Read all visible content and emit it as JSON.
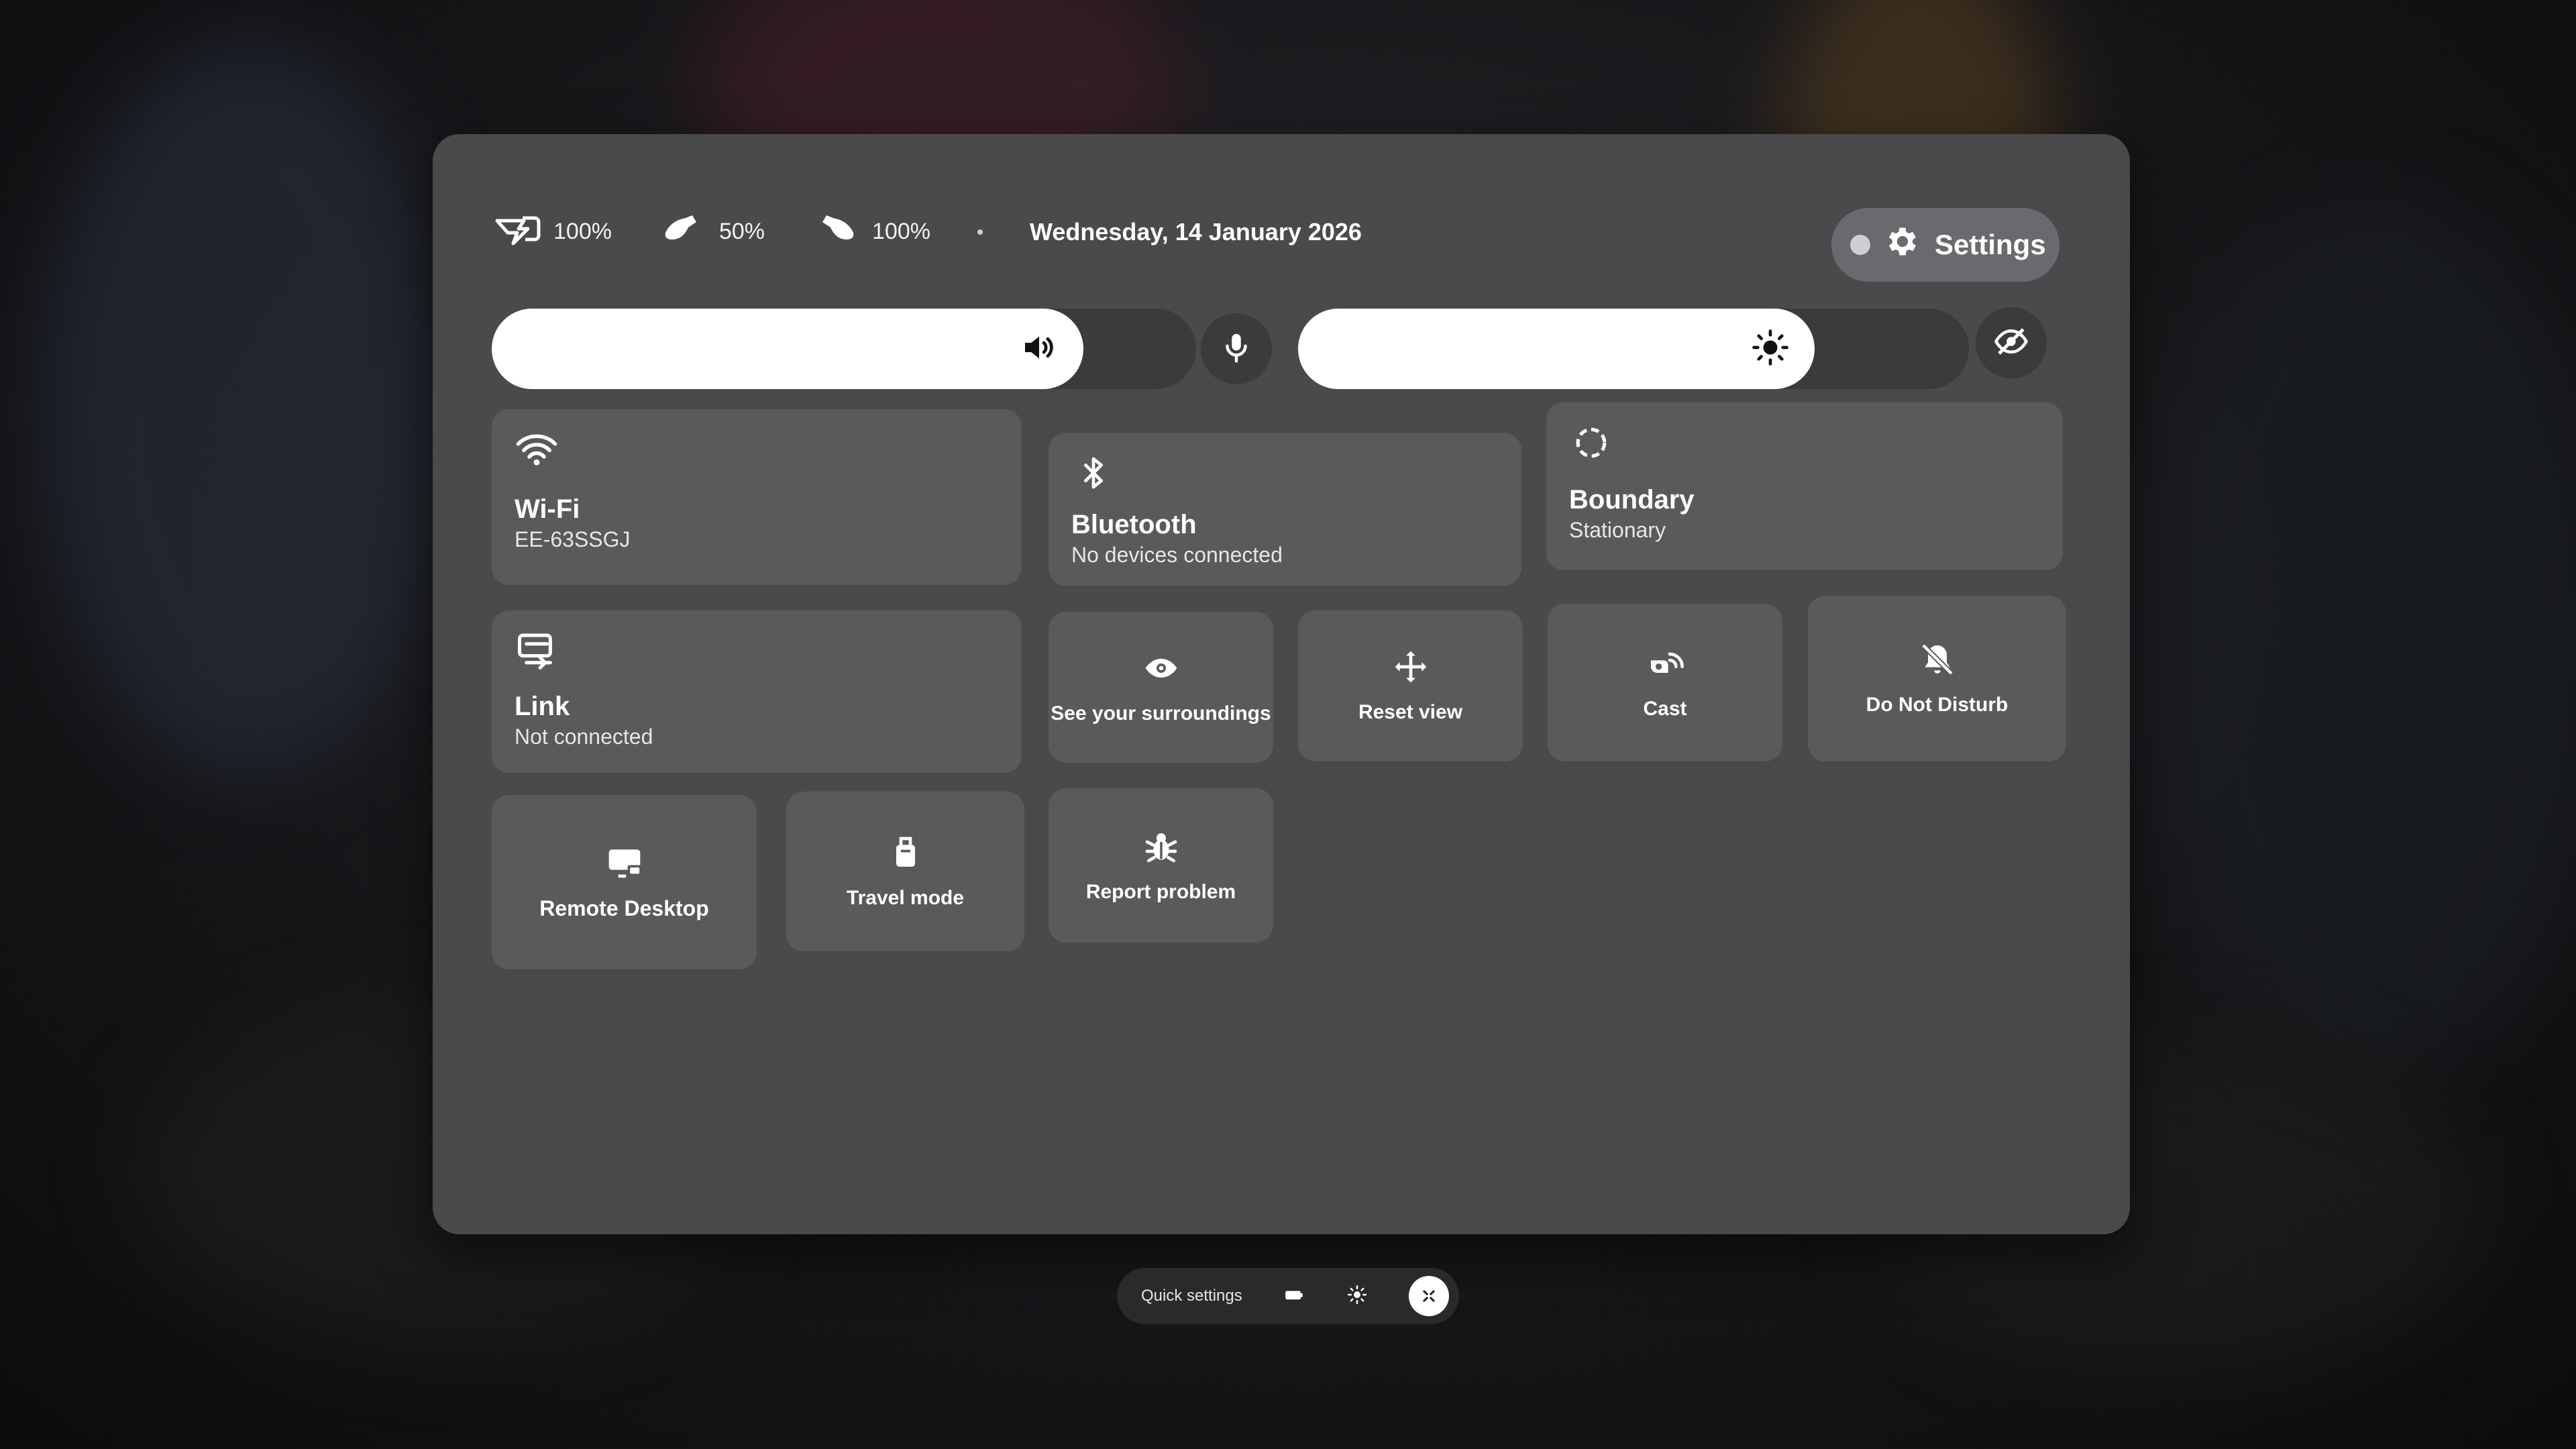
{
  "status": {
    "headset": {
      "icon": "headset-battery-charging-icon",
      "value": "100%"
    },
    "left_controller": {
      "icon": "left-controller-icon",
      "value": "50%"
    },
    "right_controller": {
      "icon": "right-controller-icon",
      "value": "100%"
    },
    "date": "Wednesday, 14 January 2026"
  },
  "settings": {
    "label": "Settings",
    "icon": "gear-icon"
  },
  "sliders": {
    "volume": {
      "icon": "speaker-icon",
      "level": 0.84
    },
    "brightness": {
      "icon": "sun-icon",
      "level": 0.77
    }
  },
  "buttons": {
    "mic": {
      "icon": "microphone-icon"
    },
    "privacy": {
      "icon": "eye-off-icon"
    }
  },
  "tiles": {
    "wifi": {
      "title": "Wi-Fi",
      "subtitle": "EE-63SSGJ",
      "icon": "wifi-icon"
    },
    "bluetooth": {
      "title": "Bluetooth",
      "subtitle": "No devices connected",
      "icon": "bluetooth-icon"
    },
    "boundary": {
      "title": "Boundary",
      "subtitle": "Stationary",
      "icon": "boundary-icon"
    },
    "link": {
      "title": "Link",
      "subtitle": "Not connected",
      "icon": "link-icon"
    },
    "see_surroundings": {
      "label": "See your surroundings",
      "icon": "eye-icon"
    },
    "reset_view": {
      "label": "Reset view",
      "icon": "move-icon"
    },
    "cast": {
      "label": "Cast",
      "icon": "cast-icon"
    },
    "dnd": {
      "label": "Do Not Disturb",
      "icon": "bell-off-icon"
    },
    "remote_desktop": {
      "label": "Remote Desktop",
      "icon": "monitor-icon"
    },
    "travel_mode": {
      "label": "Travel mode",
      "icon": "luggage-icon"
    },
    "report_problem": {
      "label": "Report problem",
      "icon": "bug-icon"
    }
  },
  "taskbar": {
    "label": "Quick settings",
    "items": [
      "battery-icon",
      "brightness-icon",
      "close-x-icon"
    ]
  },
  "colors": {
    "panel": "#4a4a4d",
    "tile": "#5a5a5d",
    "slider_track": "#3b3b3e",
    "accent": "#ffffff"
  }
}
